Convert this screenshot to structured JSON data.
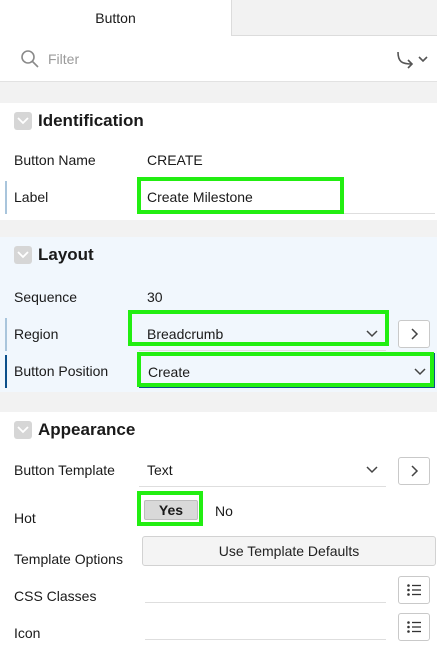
{
  "tabs": [
    {
      "label": "Button"
    }
  ],
  "filter": {
    "placeholder": "Filter"
  },
  "sections": {
    "identification": {
      "title": "Identification",
      "button_name": {
        "label": "Button Name",
        "value": "CREATE"
      },
      "label": {
        "label": "Label",
        "value": "Create Milestone"
      }
    },
    "layout": {
      "title": "Layout",
      "sequence": {
        "label": "Sequence",
        "value": "30"
      },
      "region": {
        "label": "Region",
        "value": "Breadcrumb"
      },
      "button_position": {
        "label": "Button Position",
        "value": "Create"
      }
    },
    "appearance": {
      "title": "Appearance",
      "button_template": {
        "label": "Button Template",
        "value": "Text"
      },
      "hot": {
        "label": "Hot",
        "yes": "Yes",
        "no": "No",
        "selected": "Yes"
      },
      "template_options": {
        "label": "Template Options",
        "button": "Use Template Defaults"
      },
      "css_classes": {
        "label": "CSS Classes",
        "value": ""
      },
      "icon": {
        "label": "Icon",
        "value": ""
      }
    }
  },
  "colors": {
    "highlight": "#22ee11",
    "required_marker": "#a9c5dc",
    "focus": "#0b4f8a"
  }
}
